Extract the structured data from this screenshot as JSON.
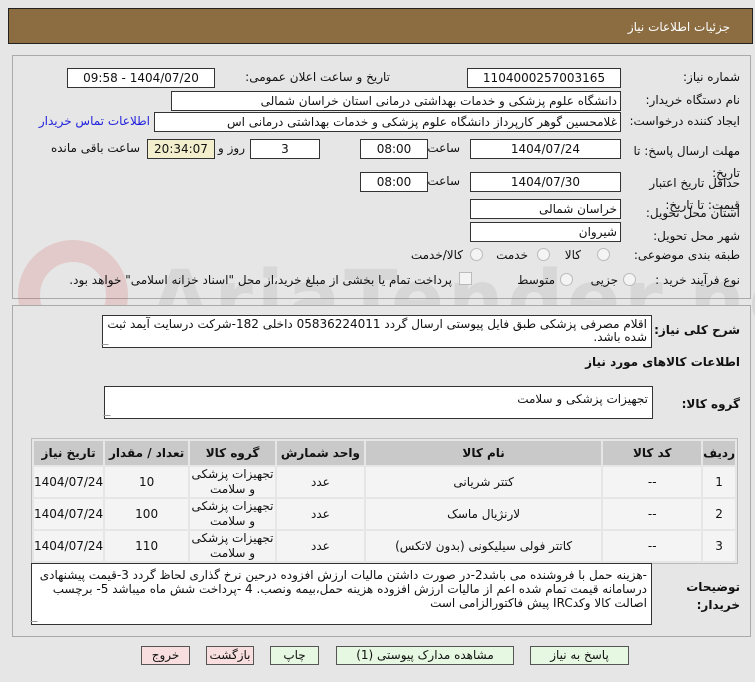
{
  "header": {
    "title": "جزئیات اطلاعات نیاز"
  },
  "form": {
    "need_number_label": "شماره نیاز:",
    "need_number": "1104000257003165",
    "announce_label": "تاریخ و ساعت اعلان عمومی:",
    "announce_value": "1404/07/20 - 09:58",
    "buyer_org_label": "نام دستگاه خریدار:",
    "buyer_org": "دانشگاه علوم پزشکی و خدمات بهداشتی درمانی استان خراسان شمالی",
    "creator_label": "ایجاد کننده درخواست:",
    "creator": "غلامحسین گوهر کارپرداز  دانشگاه علوم پزشکی و خدمات بهداشتی درمانی اس",
    "contact_link": "اطلاعات تماس خریدار",
    "deadline_label": "مهلت ارسال پاسخ: تا تاریخ:",
    "deadline_date": "1404/07/24",
    "time_label": "ساعت",
    "deadline_time": "08:00",
    "days": "3",
    "days_label": "روز و",
    "remaining": "20:34:07",
    "remaining_label": "ساعت باقی مانده",
    "validity_label": "حداقل تاریخ اعتبار قیمت: تا تاریخ:",
    "validity_date": "1404/07/30",
    "validity_time": "08:00",
    "province_label": "استان محل تحویل:",
    "province": "خراسان شمالی",
    "city_label": "شهر محل تحویل:",
    "city": "شیروان",
    "category_label": "طبقه بندی موضوعی:",
    "category_options": [
      "کالا",
      "خدمت",
      "کالا/خدمت"
    ],
    "process_label": "نوع فرآیند خرید :",
    "process_options": [
      "جزیی",
      "متوسط"
    ],
    "payment_note": "پرداخت تمام یا بخشی از مبلغ خرید،از محل \"اسناد خزانه اسلامی\" خواهد بود."
  },
  "details": {
    "desc_label": "شرح کلی نیاز:",
    "desc": "اقلام مصرفی پزشکی طبق فایل پیوستی ارسال گردد 05836224011 داخلی 182-شرکت درسایت آیمد ثبت شده باشد.",
    "goods_heading": "اطلاعات کالاهای مورد نیاز",
    "group_label": "گروه کالا:",
    "group": "تجهیزات پزشکی و سلامت",
    "table": {
      "headers": [
        "ردیف",
        "کد کالا",
        "نام کالا",
        "واحد شمارش",
        "گروه کالا",
        "تعداد / مقدار",
        "تاریخ نیاز"
      ],
      "rows": [
        [
          "1",
          "--",
          "کتتر شریانی",
          "عدد",
          "تجهیزات پزشکی و سلامت",
          "10",
          "1404/07/24"
        ],
        [
          "2",
          "--",
          "لارنژیال ماسک",
          "عدد",
          "تجهیزات پزشکی و سلامت",
          "100",
          "1404/07/24"
        ],
        [
          "3",
          "--",
          "کاتتر فولی سیلیکونی (بدون لاتکس)",
          "عدد",
          "تجهیزات پزشکی و سلامت",
          "110",
          "1404/07/24"
        ]
      ]
    },
    "notes_label": "توضیحات خریدار:",
    "notes": "-هزینه حمل با فروشنده می باشد2-در صورت داشتن مالیات ارزش افزوده درحین نرخ گذاری لحاظ گردد 3-قیمت پیشنهادی درسامانه  قیمت تمام شده اعم از مالیات ارزش افزوده هزینه حمل،بیمه ونصب.  4 -پرداخت شش ماه میباشد 5- برچسب اصالت کالا وکدIRC پیش فاکتورالزامی است"
  },
  "buttons": {
    "reply": "پاسخ به نیاز",
    "attachments": "مشاهده مدارک پیوستی (1)",
    "print": "چاپ",
    "back": "بازگشت",
    "exit": "خروج"
  },
  "watermark": "AriaTender.net"
}
